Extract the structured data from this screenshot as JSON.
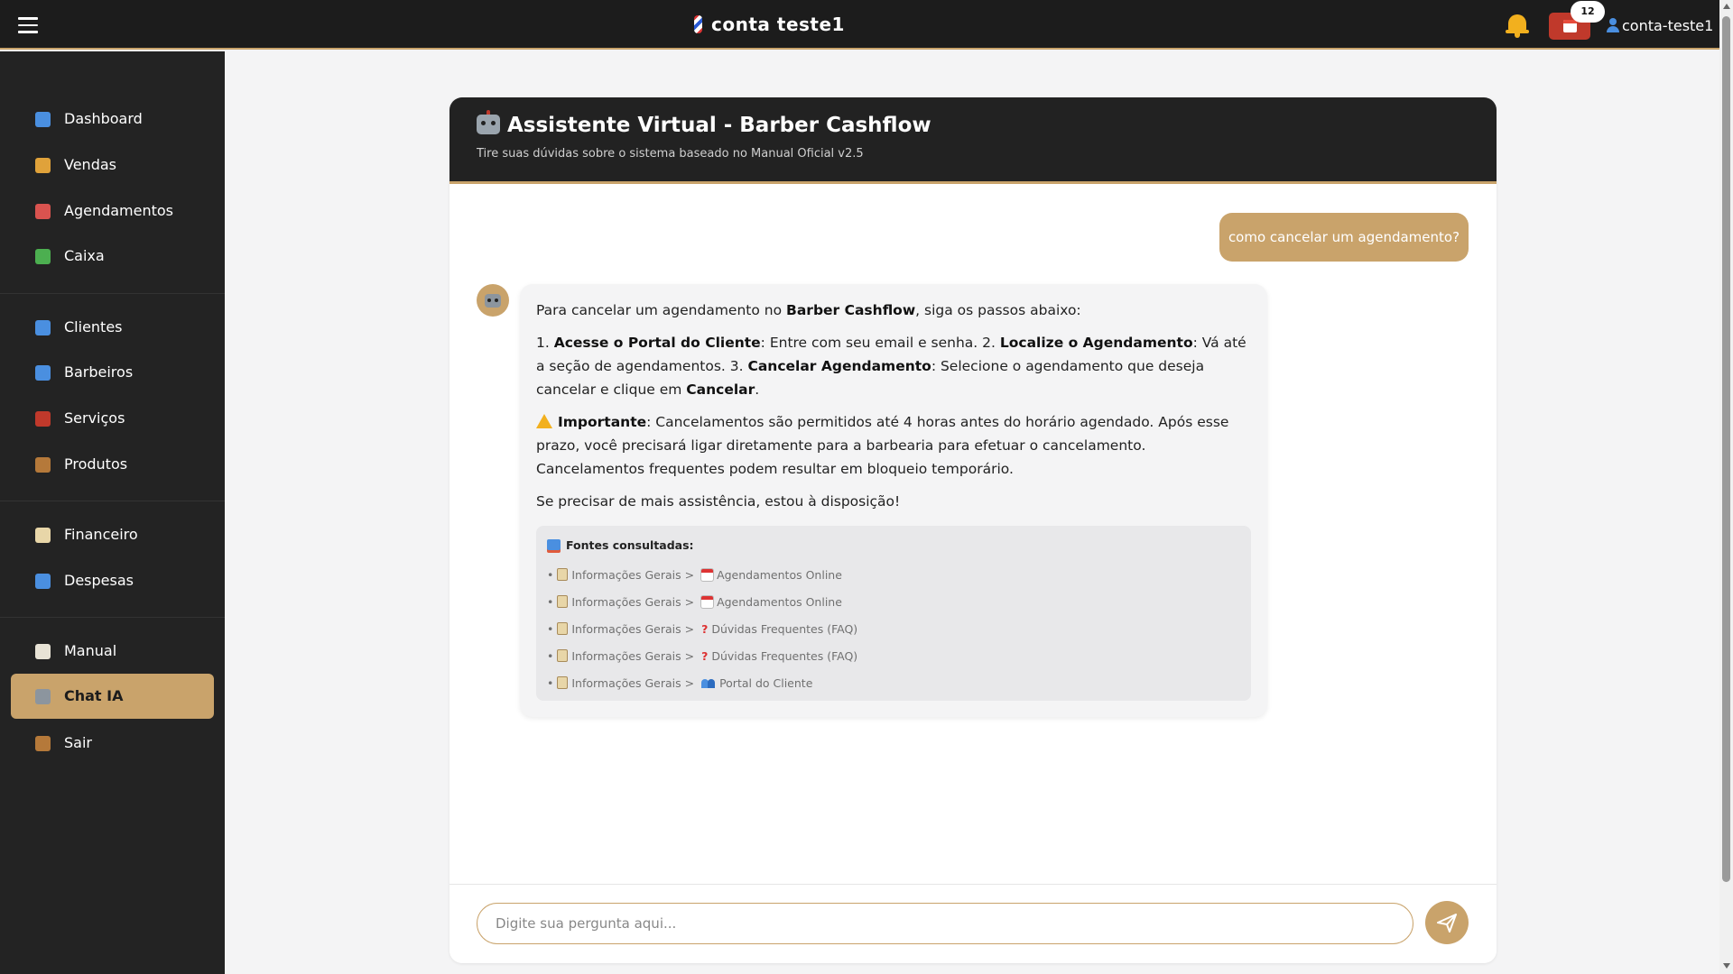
{
  "header": {
    "brand": "conta teste1",
    "notification_count": "12",
    "username": "conta-teste1"
  },
  "sidebar": {
    "items": [
      {
        "label": "Dashboard",
        "icon": "chart-icon",
        "color": "#4a8fe0"
      },
      {
        "label": "Vendas",
        "icon": "money-bag-icon",
        "color": "#e0a23a"
      },
      {
        "label": "Agendamentos",
        "icon": "calendar-icon",
        "color": "#d9534f"
      },
      {
        "label": "Caixa",
        "icon": "cash-icon",
        "color": "#4caf50"
      },
      {
        "label": "Clientes",
        "icon": "person-icon",
        "color": "#4a8fe0"
      },
      {
        "label": "Barbeiros",
        "icon": "people-icon",
        "color": "#4a8fe0"
      },
      {
        "label": "Serviços",
        "icon": "scissors-icon",
        "color": "#c0392b"
      },
      {
        "label": "Produtos",
        "icon": "package-icon",
        "color": "#b5793a"
      },
      {
        "label": "Financeiro",
        "icon": "clipboard-icon",
        "color": "#e8d6a8"
      },
      {
        "label": "Despesas",
        "icon": "chart-down-icon",
        "color": "#4a8fe0"
      },
      {
        "label": "Manual",
        "icon": "book-icon",
        "color": "#e8e3d6"
      },
      {
        "label": "Chat IA",
        "icon": "robot-icon",
        "color": "#8c959e",
        "active": true
      },
      {
        "label": "Sair",
        "icon": "door-icon",
        "color": "#b5793a"
      }
    ]
  },
  "chat": {
    "title": "Assistente Virtual - Barber Cashflow",
    "subtitle": "Tire suas dúvidas sobre o sistema baseado no Manual Oficial v2.5",
    "user_message": "como cancelar um agendamento?",
    "bot": {
      "intro_1": "Para cancelar um agendamento no ",
      "intro_brand": "Barber Cashflow",
      "intro_2": ", siga os passos abaixo:",
      "steps_1": "1. ",
      "step1_title": "Acesse o Portal do Cliente",
      "step1_text": ": Entre com seu email e senha. 2. ",
      "step2_title": "Localize o Agendamento",
      "step2_text": ": Vá até a seção de agendamentos. 3. ",
      "step3_title": "Cancelar Agendamento",
      "step3_text": ": Selecione o agendamento que deseja cancelar e clique em ",
      "step3_action": "Cancelar",
      "step3_end": ".",
      "important_label": "Importante",
      "important_text": ": Cancelamentos são permitidos até 4 horas antes do horário agendado. Após esse prazo, você precisará ligar diretamente para a barbearia para efetuar o cancelamento. Cancelamentos frequentes podem resultar em bloqueio temporário.",
      "closing": "Se precisar de mais assistência, estou à disposição!",
      "sources_title": "Fontes consultadas:",
      "sources": [
        {
          "section": "Informações Gerais",
          "topic": "Agendamentos Online",
          "icon": "calendar"
        },
        {
          "section": "Informações Gerais",
          "topic": "Agendamentos Online",
          "icon": "calendar"
        },
        {
          "section": "Informações Gerais",
          "topic": "Dúvidas Frequentes (FAQ)",
          "icon": "question"
        },
        {
          "section": "Informações Gerais",
          "topic": "Dúvidas Frequentes (FAQ)",
          "icon": "question"
        },
        {
          "section": "Informações Gerais",
          "topic": "Portal do Cliente",
          "icon": "people"
        }
      ]
    },
    "input_placeholder": "Digite sua pergunta aqui..."
  },
  "colors": {
    "accent": "#c9a36b",
    "topbar": "#1c1c1c",
    "sidebar": "#232323"
  }
}
